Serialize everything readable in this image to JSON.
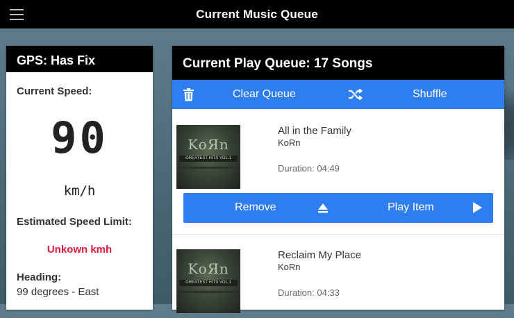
{
  "app": {
    "title": "Current Music Queue"
  },
  "gps": {
    "status": "GPS: Has Fix",
    "speed_label": "Current Speed:",
    "speed_value": "90",
    "speed_unit": "km/h",
    "limit_label": "Estimated Speed Limit:",
    "limit_value": "Unkown kmh",
    "heading_label": "Heading:",
    "heading_value": "99 degrees - East"
  },
  "queue": {
    "title": "Current Play Queue: 17 Songs",
    "clear_label": "Clear Queue",
    "shuffle_label": "Shuffle",
    "items": [
      {
        "title": "All in the Family",
        "artist": "KoRn",
        "duration": "Duration: 04:49",
        "remove_label": "Remove",
        "play_label": "Play Item"
      },
      {
        "title": "Reclaim My Place",
        "artist": "KoRn",
        "duration": "Duration: 04:33"
      }
    ]
  },
  "icons": {
    "menu": "hamburger-menu-icon",
    "clear": "trash-icon",
    "shuffle": "shuffle-icon",
    "eject": "eject-icon",
    "play": "play-icon"
  },
  "colors": {
    "accent": "#2f7ef0",
    "warning": "#e8163c",
    "bar": "#000000"
  }
}
